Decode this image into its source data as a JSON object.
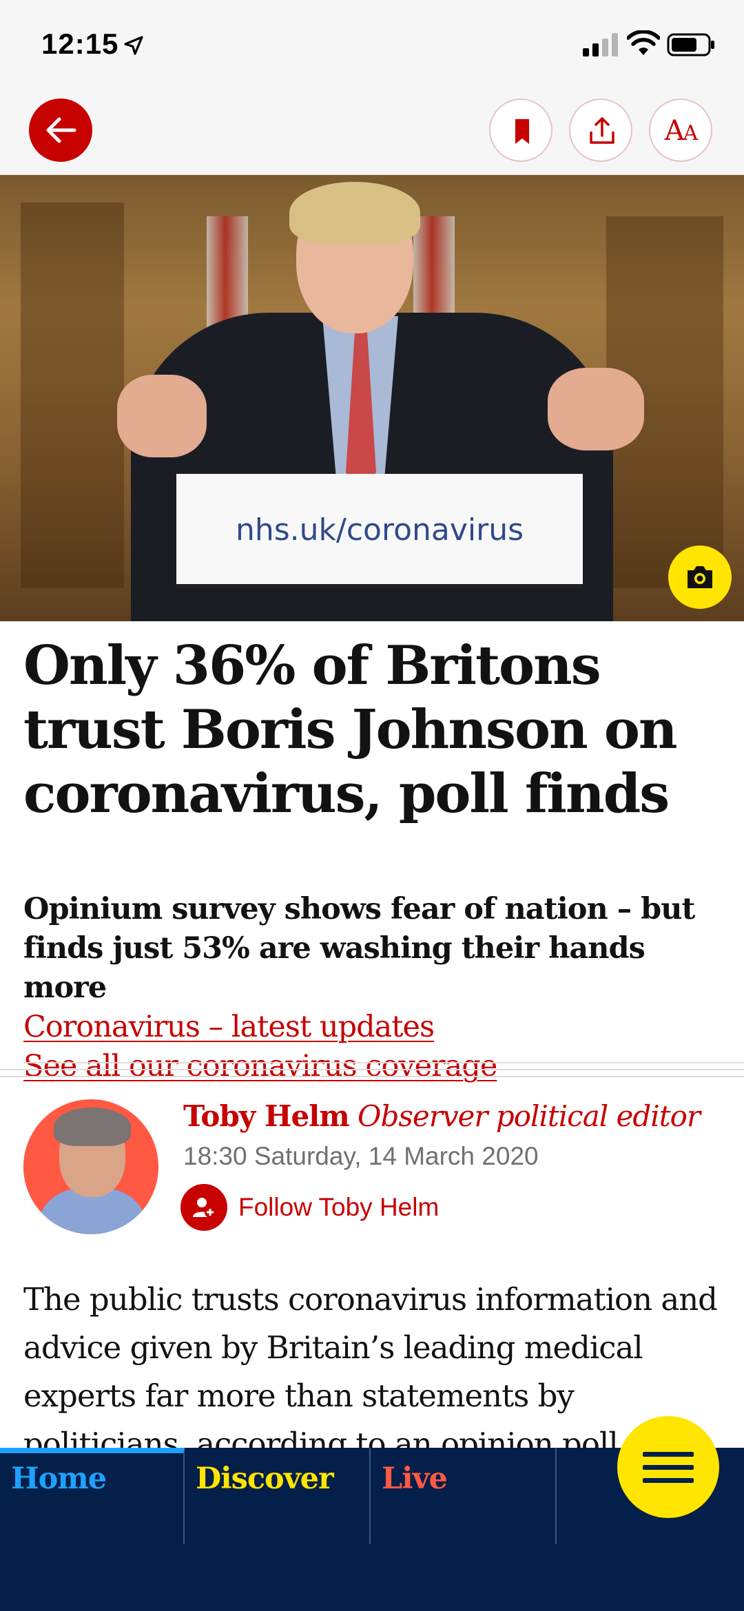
{
  "status_bar": {
    "time": "12:15",
    "icons": [
      "location-arrow-icon",
      "signal-icon",
      "wifi-icon",
      "battery-icon"
    ]
  },
  "toolbar": {
    "back_icon": "arrow-left-icon",
    "bookmark_icon": "bookmark-icon",
    "share_icon": "share-icon",
    "text_size_label_large": "A",
    "text_size_label_small": "A"
  },
  "hero": {
    "podium_text": "nhs.uk/coronavirus",
    "camera_icon": "camera-icon"
  },
  "article": {
    "headline": "Only 36% of Britons trust Boris Johnson on coronavirus, poll finds",
    "standfirst": "Opinium survey shows fear of nation – but finds just 53% are washing their hands more",
    "links": [
      {
        "label": "Coronavirus – latest updates"
      },
      {
        "label": "See all our coronavirus coverage"
      }
    ],
    "byline": {
      "author": "Toby Helm",
      "role": "Observer political editor",
      "date": "18:30 Saturday, 14 March 2020",
      "follow_label": "Follow Toby Helm"
    },
    "body": "The public trusts coronavirus information and advice given by Britain’s leading medical experts far more than statements by politicians, according to an opinion poll"
  },
  "bottom_nav": {
    "tabs": [
      {
        "label": "Home",
        "color": "#1fa0ff"
      },
      {
        "label": "Discover",
        "color": "#ffe500"
      },
      {
        "label": "Live",
        "color": "#ff5943"
      }
    ],
    "menu_icon": "menu-icon"
  },
  "colors": {
    "accent_red": "#c70000",
    "nav_background": "#041f4a",
    "highlight_yellow": "#ffe500"
  }
}
